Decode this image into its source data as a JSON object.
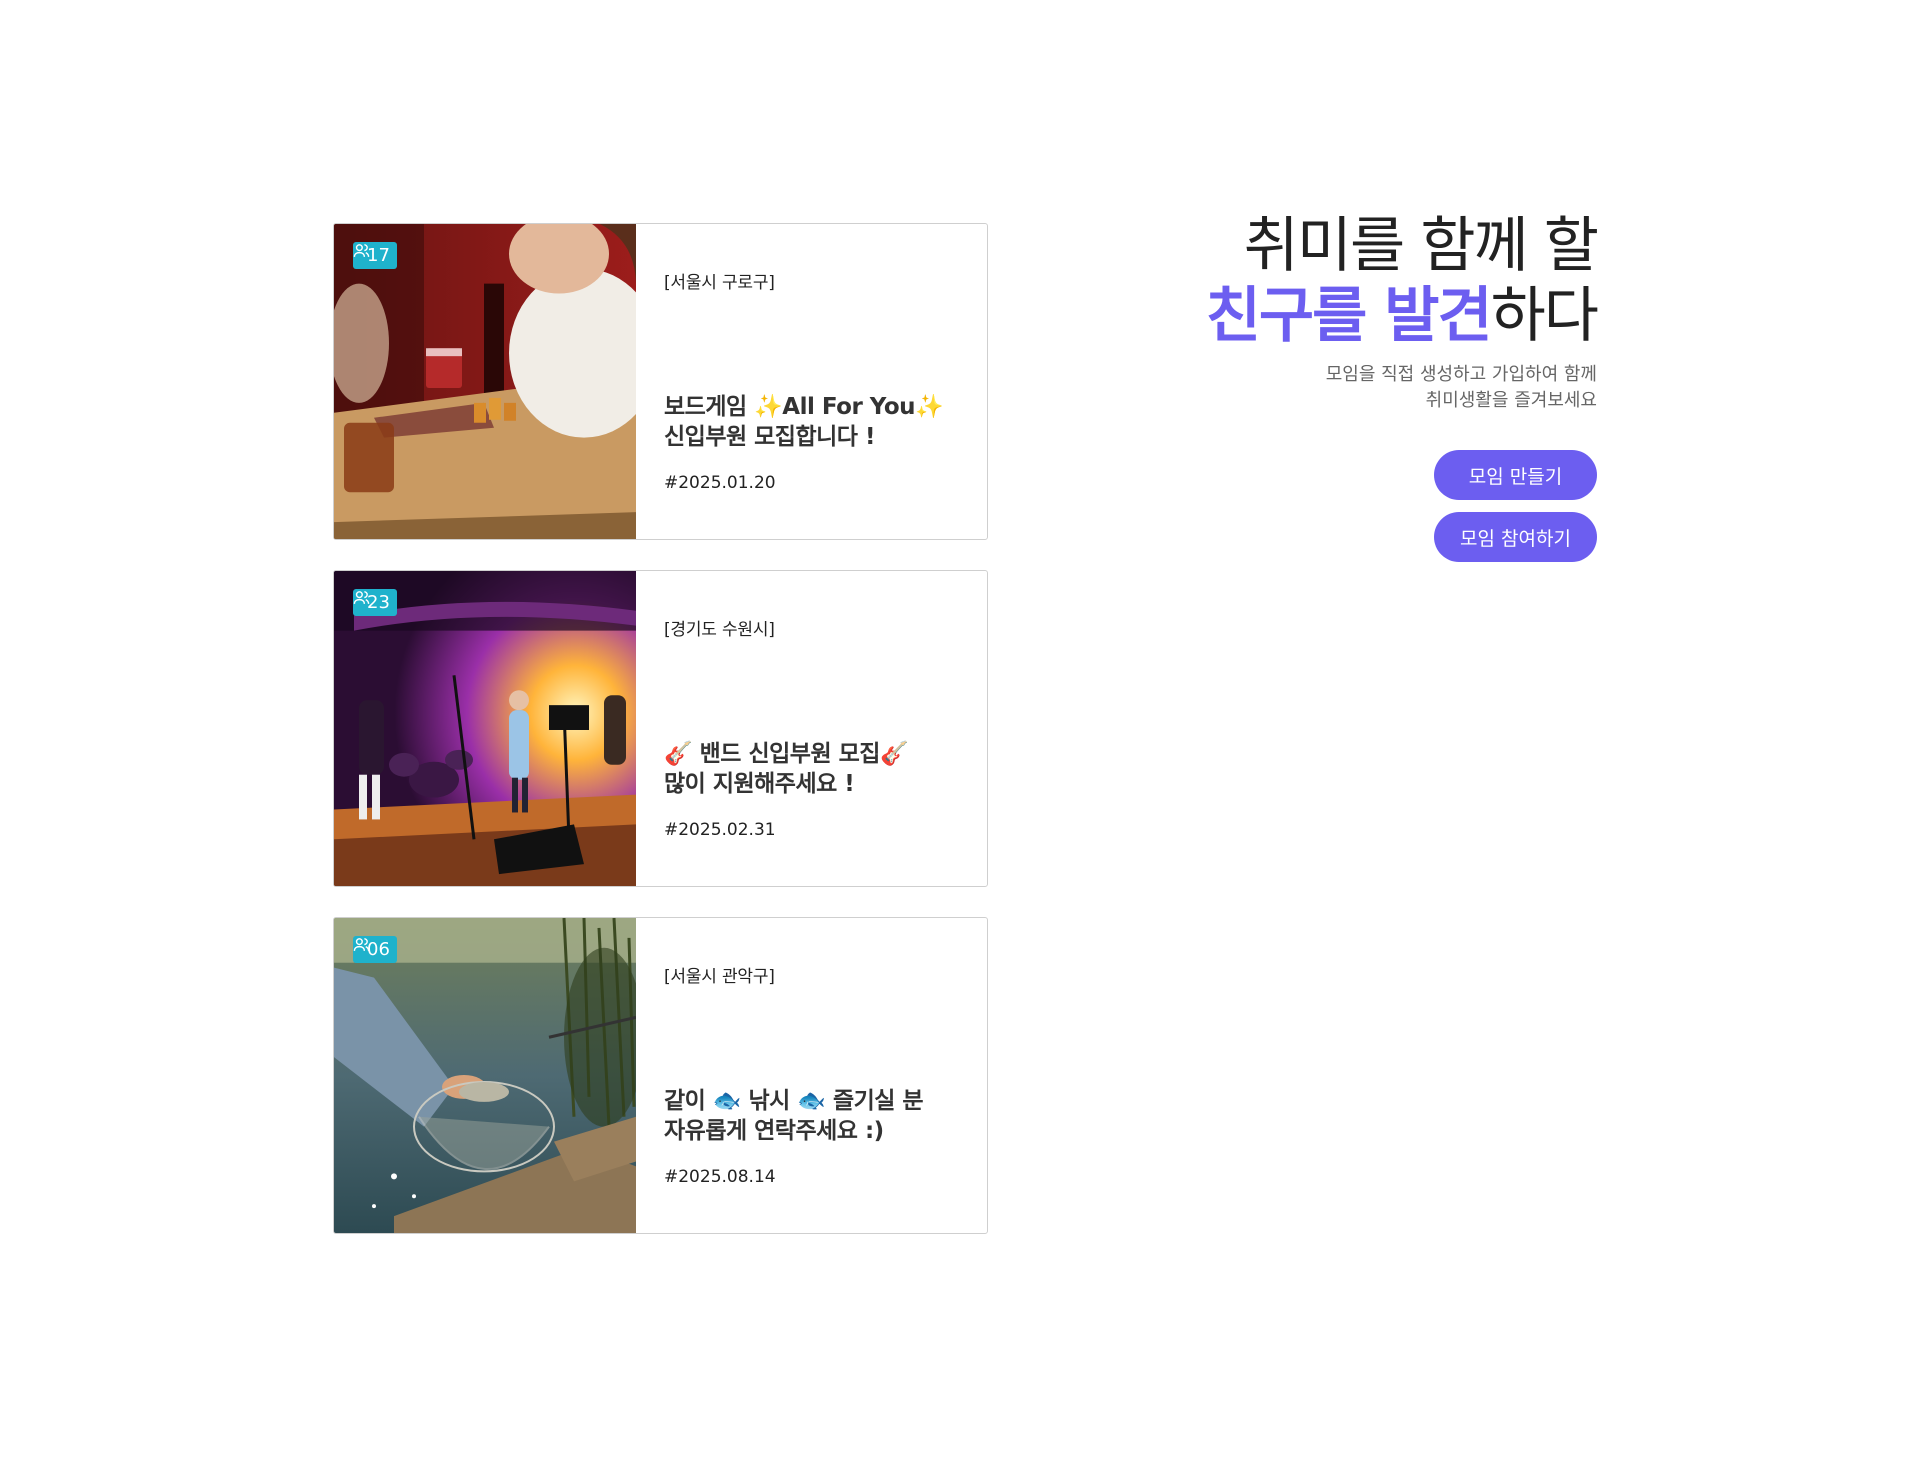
{
  "hero": {
    "title_line1": "취미를 함께 할",
    "title_highlight": "친구를 발견",
    "title_suffix": "하다",
    "subtitle_line1": "모임을 직접 생성하고 가입하여 함께",
    "subtitle_line2": "취미생활을 즐겨보세요",
    "create_button": "모임 만들기",
    "join_button": "모임 참여하기"
  },
  "cards": [
    {
      "members": "17",
      "location": "[서울시 구로구]",
      "title_line1": "보드게임 ✨All For You✨",
      "title_line2": "신입부원 모집합니다 !",
      "date": "#2025.01.20",
      "photo_icon": "board-game-photo"
    },
    {
      "members": "23",
      "location": "[경기도 수원시]",
      "title_line1": "🎸 밴드 신입부원 모집🎸",
      "title_line2": "많이 지원해주세요 !",
      "date": "#2025.02.31",
      "photo_icon": "band-stage-photo"
    },
    {
      "members": "06",
      "location": "[서울시 관악구]",
      "title_line1": "같이 🐟 낚시 🐟 즐기실 분",
      "title_line2": "자유롭게 연락주세요 :)",
      "date": "#2025.08.14",
      "photo_icon": "fishing-net-photo"
    }
  ],
  "colors": {
    "accent": "#6c5ef0",
    "badge": "#1fb2cc"
  }
}
